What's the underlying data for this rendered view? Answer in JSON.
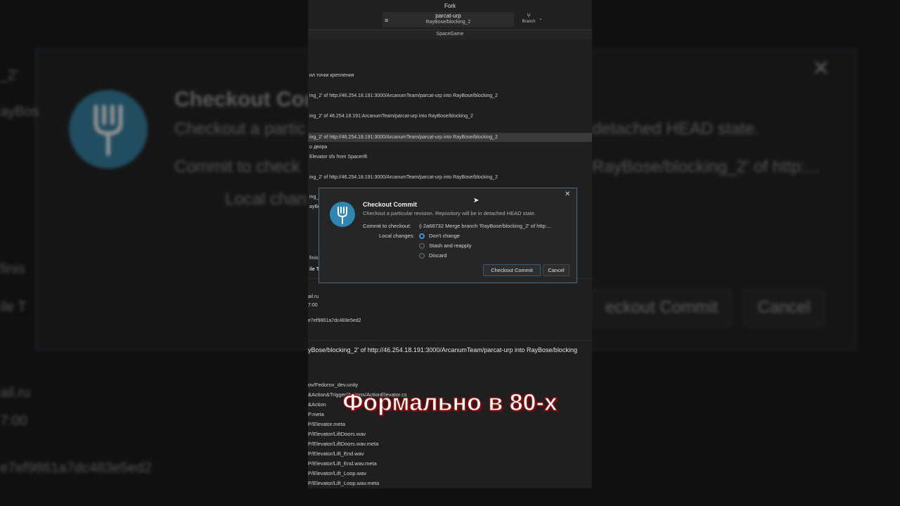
{
  "background": {
    "title": "Checkout Com",
    "subtitle_left": "Checkout a partic",
    "subtitle_right": "detached HEAD state.",
    "commit_label": "Commit to check",
    "commit_value": "RayBose/blocking_2' of http:...",
    "local_changes": "Local chan",
    "left_texts": [
      "_2'",
      "ayBos",
      "finis",
      "ile T",
      "ail.ru",
      "7:00",
      "e7ef9861a7dc483e5ed2"
    ],
    "close_glyph": "✕",
    "checkout_button": "eckout Commit",
    "cancel_button": "Cancel"
  },
  "window": {
    "title": "Fork",
    "repo_name": "parcat-urp",
    "repo_branch": "RayBose/blocking_2",
    "branch_button": "Branch",
    "tab": "SpaceGame"
  },
  "commits": [
    "ил точки крепления",
    "ing_2' of http://46.254.18.191:3000/ArcanumTeam/parcat-urp into RayBose/blocking_2",
    "ing_2' of 46.254.18.191:ArcanumTeam/parcat-urp into RayBose/blocking_2",
    "ing_2' of http://46.254.18.191:3000/ArcanumTeam/parcat-urp into RayBose/blocking_2",
    "о двора",
    "Elevator sfx from Spacerift",
    "ing_2' of http://46.254.18.191:3000/ArcanumTeam/parcat-urp into RayBose/blocking_2",
    "ing_2'",
    "ayBos",
    "finish",
    "ile T"
  ],
  "details": {
    "author": "ail.ru",
    "time": "7:00",
    "sha": "e7ef9861a7dc483e5ed2",
    "message": "yBose/blocking_2' of http://46.254.18.191:3000/ArcanumTeam/parcat-urp into RayBose/blocking"
  },
  "files": [
    "ov/Fedorov_dev.unity",
    "&Action&Trigger/Actions/ActionElevator.cs",
    "&Action",
    "P.meta",
    "P/Elevator.meta",
    "P/Elevator/LiftDoors.wav",
    "P/Elevator/LiftDoors.wav.meta",
    "P/Elevator/Lift_End.wav",
    "P/Elevator/Lift_End.wav.meta",
    "P/Elevator/Lift_Loop.wav",
    "P/Elevator/Lift_Loop.wav.meta"
  ],
  "dialog": {
    "title": "Checkout Commit",
    "subtitle": "Checkout a particular revision. Repository will be in detached HEAD state.",
    "commit_label": "Commit to checkout:",
    "commit_value": "2a68732  Merge branch 'RayBose/blocking_2' of http:...",
    "local_changes_label": "Local changes:",
    "options": [
      "Don't change",
      "Stash and reapply",
      "Discard"
    ],
    "selected_option": "Don't change",
    "checkout_button": "Checkout Commit",
    "cancel_button": "Cancel",
    "close_glyph": "✕"
  },
  "caption": "Формально в 80-х",
  "colors": {
    "accent": "#3c96d6",
    "logo": "#2f86b0",
    "caption_outline": "#8a0f0f"
  }
}
